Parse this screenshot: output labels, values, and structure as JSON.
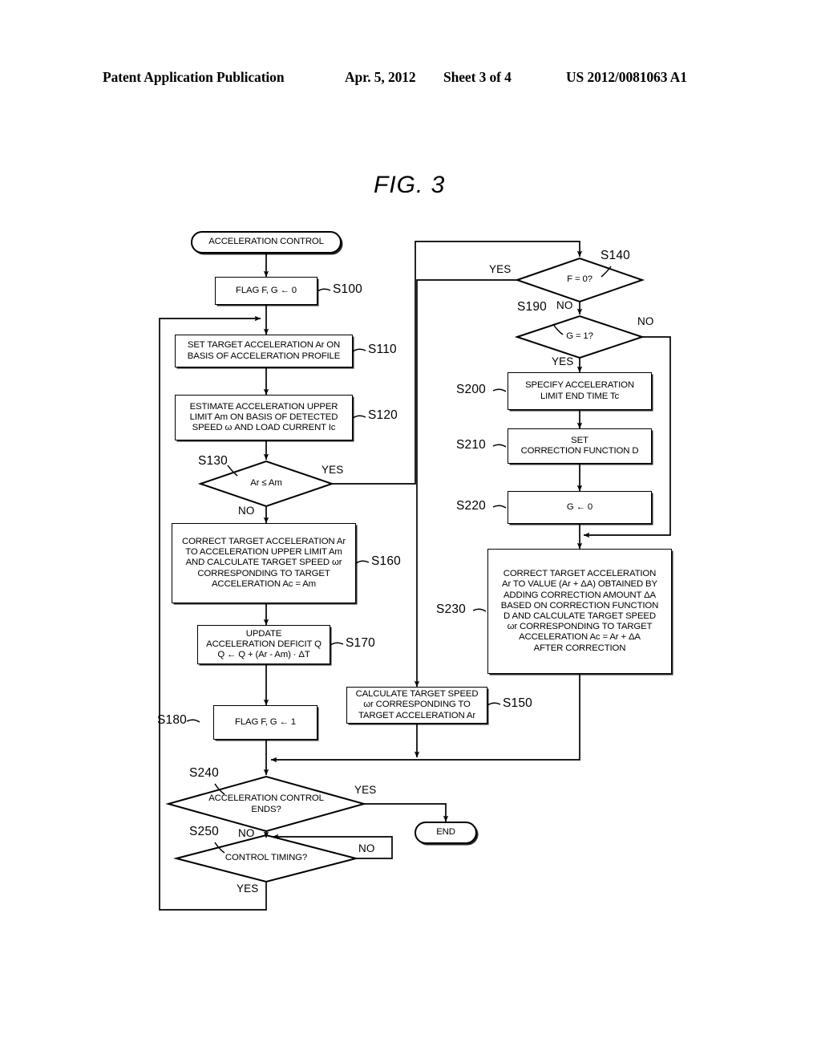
{
  "header": {
    "publication": "Patent Application Publication",
    "date": "Apr. 5, 2012",
    "sheet": "Sheet 3 of 4",
    "number": "US 2012/0081063 A1"
  },
  "figure": {
    "title": "FIG. 3"
  },
  "nodes": {
    "start": "ACCELERATION CONTROL",
    "s100": "FLAG F, G ← 0",
    "s110": "SET TARGET ACCELERATION Ar ON\nBASIS OF ACCELERATION PROFILE",
    "s120": "ESTIMATE ACCELERATION UPPER\nLIMIT Am ON BASIS OF DETECTED\nSPEED ω AND LOAD CURRENT Ic",
    "s130": "Ar ≤ Am",
    "s140": "F = 0?",
    "s150": "CALCULATE TARGET SPEED\nωr CORRESPONDING TO\nTARGET ACCELERATION Ar",
    "s160": "CORRECT TARGET ACCELERATION Ar\nTO ACCELERATION UPPER LIMIT Am\nAND CALCULATE TARGET SPEED ωr\nCORRESPONDING TO TARGET\nACCELERATION Ac = Am",
    "s170": "UPDATE\nACCELERATION DEFICIT Q\nQ ← Q + (Ar - Am) · ΔT",
    "s180": "FLAG F, G ← 1",
    "s190": "G = 1?",
    "s200": "SPECIFY ACCELERATION\nLIMIT END TIME Tc",
    "s210": "SET\nCORRECTION FUNCTION D",
    "s220": "G ← 0",
    "s230": "CORRECT TARGET ACCELERATION\nAr TO VALUE (Ar + ΔA) OBTAINED BY\nADDING CORRECTION AMOUNT ΔA\nBASED ON CORRECTION FUNCTION\nD AND CALCULATE TARGET SPEED\nωr CORRESPONDING TO TARGET\nACCELERATION Ac = Ar + ΔA\nAFTER CORRECTION",
    "s240": "ACCELERATION CONTROL\nENDS?",
    "s250": "CONTROL TIMING?",
    "end": "END"
  },
  "steptags": {
    "s100": "S100",
    "s110": "S110",
    "s120": "S120",
    "s130": "S130",
    "s140": "S140",
    "s150": "S150",
    "s160": "S160",
    "s170": "S170",
    "s180": "S180",
    "s190": "S190",
    "s200": "S200",
    "s210": "S210",
    "s220": "S220",
    "s230": "S230",
    "s240": "S240",
    "s250": "S250"
  },
  "branches": {
    "s130_yes": "YES",
    "s130_no": "NO",
    "s140_yes": "YES",
    "s140_no": "NO",
    "s190_yes": "YES",
    "s190_no": "NO",
    "s240_yes": "YES",
    "s240_no": "NO",
    "s250_yes": "YES",
    "s250_no": "NO"
  },
  "colors": {
    "ink": "#000000",
    "paper": "#ffffff"
  },
  "chart_data": {
    "type": "diagram",
    "title": "FIG. 3 — Acceleration control flowchart",
    "steps": [
      {
        "id": "start",
        "shape": "terminator",
        "label": "ACCELERATION CONTROL"
      },
      {
        "id": "S100",
        "shape": "process",
        "label": "FLAG F, G ← 0"
      },
      {
        "id": "S110",
        "shape": "process",
        "label": "SET TARGET ACCELERATION Ar ON BASIS OF ACCELERATION PROFILE"
      },
      {
        "id": "S120",
        "shape": "process",
        "label": "ESTIMATE ACCELERATION UPPER LIMIT Am ON BASIS OF DETECTED SPEED ω AND LOAD CURRENT Ic"
      },
      {
        "id": "S130",
        "shape": "decision",
        "label": "Ar ≤ Am"
      },
      {
        "id": "S140",
        "shape": "decision",
        "label": "F = 0?"
      },
      {
        "id": "S150",
        "shape": "process",
        "label": "CALCULATE TARGET SPEED ωr CORRESPONDING TO TARGET ACCELERATION Ar"
      },
      {
        "id": "S160",
        "shape": "process",
        "label": "CORRECT TARGET ACCELERATION Ar TO ACCELERATION UPPER LIMIT Am AND CALCULATE TARGET SPEED ωr CORRESPONDING TO TARGET ACCELERATION Ac = Am"
      },
      {
        "id": "S170",
        "shape": "process",
        "label": "UPDATE ACCELERATION DEFICIT Q  Q ← Q + (Ar - Am) · ΔT"
      },
      {
        "id": "S180",
        "shape": "process",
        "label": "FLAG F, G ← 1"
      },
      {
        "id": "S190",
        "shape": "decision",
        "label": "G = 1?"
      },
      {
        "id": "S200",
        "shape": "process",
        "label": "SPECIFY ACCELERATION LIMIT END TIME Tc"
      },
      {
        "id": "S210",
        "shape": "process",
        "label": "SET CORRECTION FUNCTION D"
      },
      {
        "id": "S220",
        "shape": "process",
        "label": "G ← 0"
      },
      {
        "id": "S230",
        "shape": "process",
        "label": "CORRECT TARGET ACCELERATION Ar TO VALUE (Ar + ΔA) OBTAINED BY ADDING CORRECTION AMOUNT ΔA BASED ON CORRECTION FUNCTION D AND CALCULATE TARGET SPEED ωr CORRESPONDING TO TARGET ACCELERATION Ac = Ar + ΔA AFTER CORRECTION"
      },
      {
        "id": "S240",
        "shape": "decision",
        "label": "ACCELERATION CONTROL ENDS?"
      },
      {
        "id": "S250",
        "shape": "decision",
        "label": "CONTROL TIMING?"
      },
      {
        "id": "end",
        "shape": "terminator",
        "label": "END"
      }
    ],
    "edges": [
      {
        "from": "start",
        "to": "S100",
        "label": ""
      },
      {
        "from": "S100",
        "to": "S110",
        "label": ""
      },
      {
        "from": "S110",
        "to": "S120",
        "label": ""
      },
      {
        "from": "S120",
        "to": "S130",
        "label": ""
      },
      {
        "from": "S130",
        "to": "S140",
        "label": "YES"
      },
      {
        "from": "S130",
        "to": "S160",
        "label": "NO"
      },
      {
        "from": "S140",
        "to": "S150",
        "label": "YES"
      },
      {
        "from": "S140",
        "to": "S190",
        "label": "NO"
      },
      {
        "from": "S190",
        "to": "S200",
        "label": "YES"
      },
      {
        "from": "S190",
        "to": "S230",
        "label": "NO"
      },
      {
        "from": "S200",
        "to": "S210",
        "label": ""
      },
      {
        "from": "S210",
        "to": "S220",
        "label": ""
      },
      {
        "from": "S220",
        "to": "S230",
        "label": ""
      },
      {
        "from": "S230",
        "to": "S240",
        "label": ""
      },
      {
        "from": "S150",
        "to": "S240",
        "label": ""
      },
      {
        "from": "S160",
        "to": "S170",
        "label": ""
      },
      {
        "from": "S170",
        "to": "S180",
        "label": ""
      },
      {
        "from": "S180",
        "to": "S240",
        "label": ""
      },
      {
        "from": "S240",
        "to": "end",
        "label": "YES"
      },
      {
        "from": "S240",
        "to": "S250",
        "label": "NO"
      },
      {
        "from": "S250",
        "to": "S110",
        "label": "YES"
      },
      {
        "from": "S250",
        "to": "S240",
        "label": "NO"
      }
    ]
  }
}
